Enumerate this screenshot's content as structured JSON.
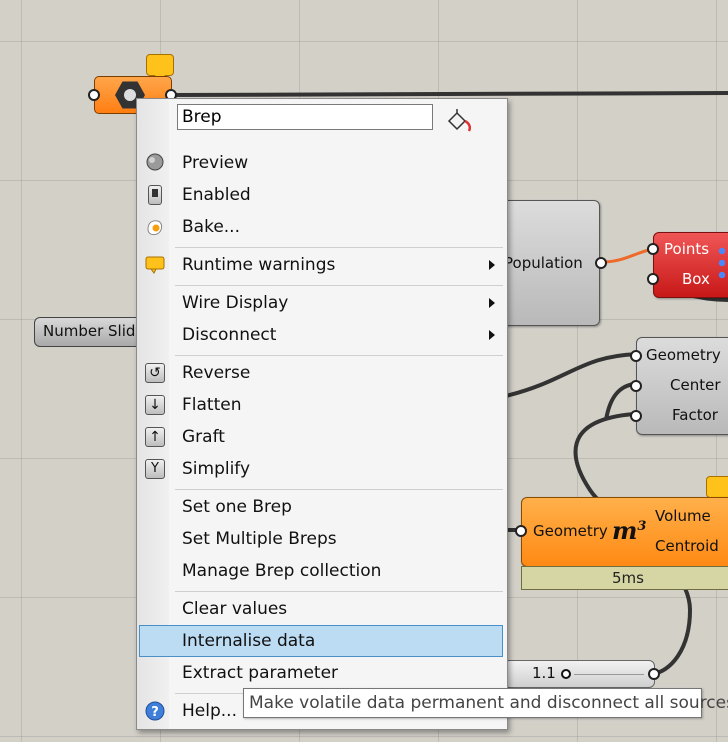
{
  "canvas": {
    "number_slider_label": "Number Slider",
    "population_node": {
      "label": "Population"
    },
    "populate_node": {
      "inputs": [
        "Points",
        "Box"
      ]
    },
    "scale_node": {
      "inputs": [
        "Geometry",
        "Center",
        "Factor"
      ]
    },
    "volume_node": {
      "input": "Geometry",
      "symbol": "m",
      "symbol_exp": "3",
      "outputs": [
        "Volume",
        "Centroid"
      ],
      "timing": "5ms"
    },
    "slider2_value": "1.1"
  },
  "menu": {
    "name_field_value": "Brep",
    "items": {
      "preview": "Preview",
      "enabled": "Enabled",
      "bake": "Bake...",
      "runtime_warnings": "Runtime warnings",
      "wire_display": "Wire Display",
      "disconnect": "Disconnect",
      "reverse": "Reverse",
      "flatten": "Flatten",
      "graft": "Graft",
      "simplify": "Simplify",
      "set_one": "Set one Brep",
      "set_multiple": "Set Multiple Breps",
      "manage": "Manage Brep collection",
      "clear": "Clear values",
      "internalise": "Internalise data",
      "extract": "Extract parameter",
      "help": "Help..."
    }
  },
  "tooltip": "Make volatile data permanent and disconnect all sources",
  "colors": {
    "highlight": "#bcdcf4",
    "orange": "#ff8a14",
    "red": "#d92b2b",
    "bubble": "#ffc21a"
  }
}
